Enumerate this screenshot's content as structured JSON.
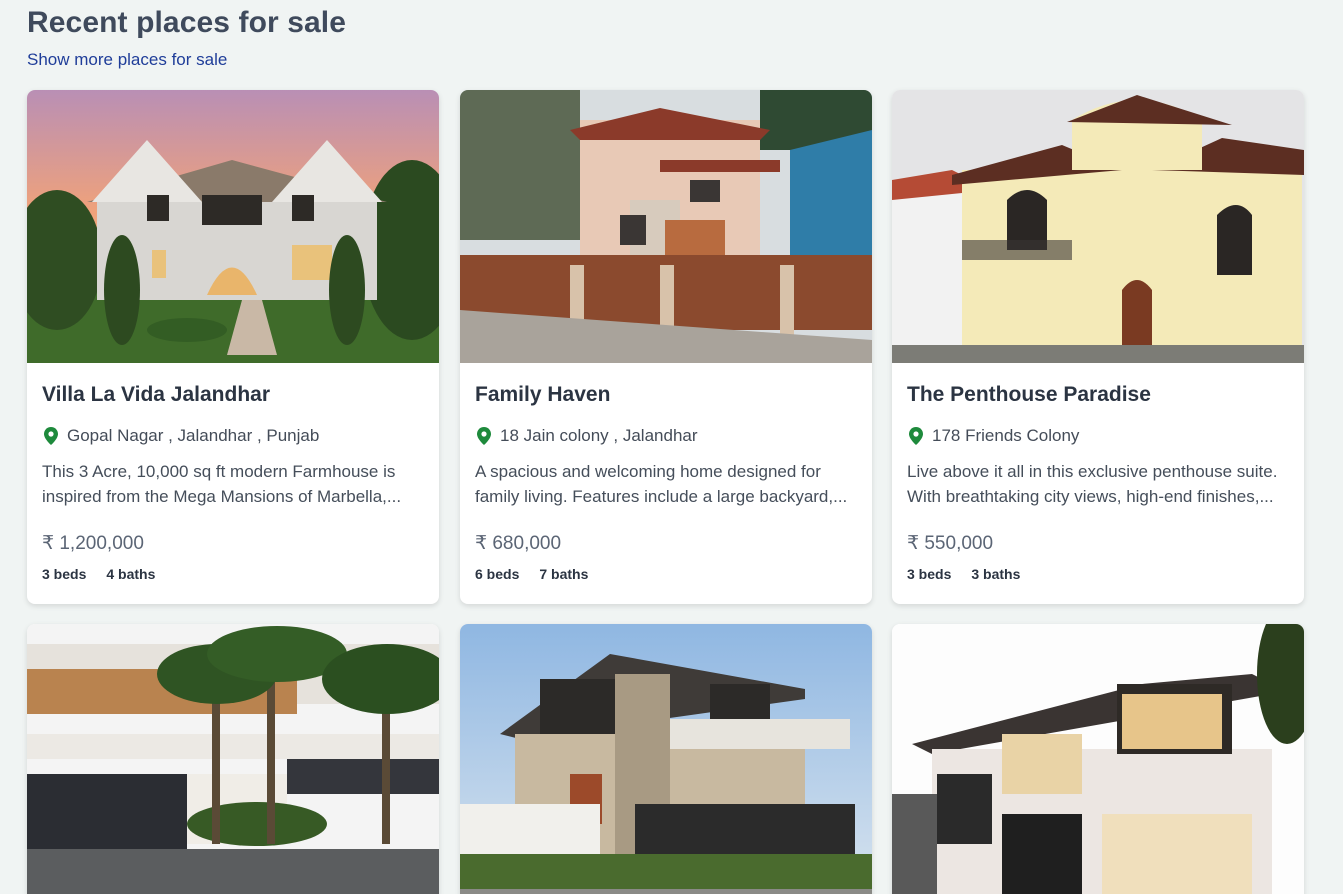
{
  "header": {
    "title": "Recent places for sale",
    "more_link": "Show more places for sale"
  },
  "listings": [
    {
      "title": "Villa La Vida Jalandhar",
      "location": "Gopal Nagar , Jalandhar , Punjab",
      "description": "This 3 Acre, 10,000 sq ft modern Farmhouse is inspired from the Mega Mansions of Marbella,...",
      "price": "₹ 1,200,000",
      "beds": "3 beds",
      "baths": "4 baths"
    },
    {
      "title": "Family Haven",
      "location": "18 Jain colony , Jalandhar",
      "description": "A spacious and welcoming home designed for family living. Features include a large backyard,...",
      "price": "₹ 680,000",
      "beds": "6 beds",
      "baths": "7 baths"
    },
    {
      "title": "The Penthouse Paradise",
      "location": "178 Friends Colony",
      "description": "Live above it all in this exclusive penthouse suite. With breathtaking city views, high-end finishes,...",
      "price": "₹ 550,000",
      "beds": "3 beds",
      "baths": "3 baths"
    }
  ],
  "colors": {
    "background": "#f0f4f3",
    "link": "#1f3d99",
    "pin": "#1e8a3c",
    "heading": "#3f4a5c"
  },
  "icons": {
    "location": "map-pin-icon"
  }
}
